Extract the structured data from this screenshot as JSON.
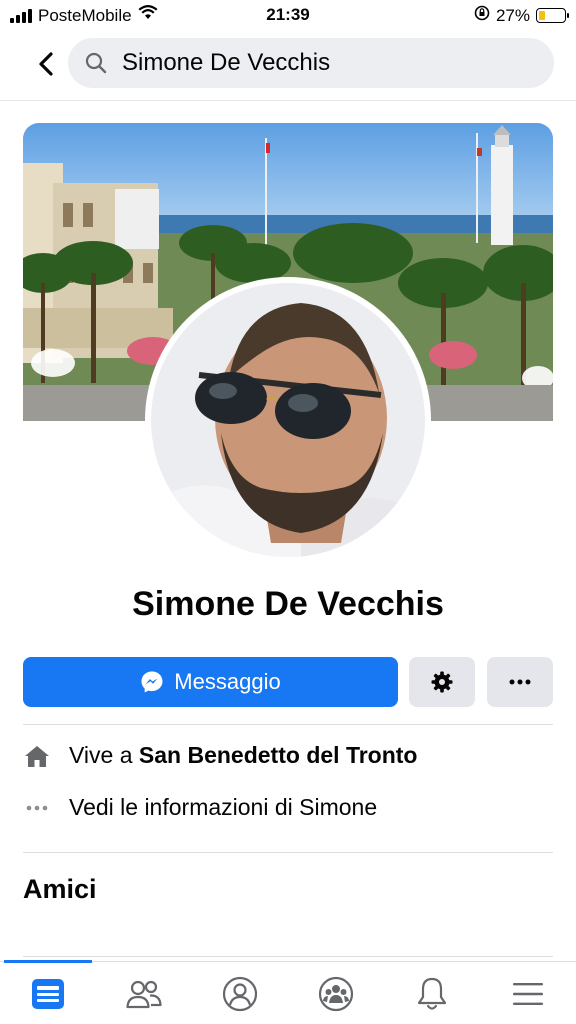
{
  "status_bar": {
    "carrier": "PosteMobile",
    "time": "21:39",
    "battery_percent": "27%",
    "battery_level": 0.27,
    "icons": [
      "signal-icon",
      "wifi-icon",
      "orientation-lock-icon",
      "battery-icon"
    ]
  },
  "header": {
    "back_icon": "chevron-left-icon",
    "search_icon": "search-icon",
    "search_text": "Simone De Vecchis"
  },
  "profile": {
    "name": "Simone De Vecchis"
  },
  "actions": {
    "message_label": "Messaggio",
    "message_icon": "messenger-icon",
    "settings_icon": "gear-icon",
    "more_icon": "more-icon",
    "primary_color": "#1877f2"
  },
  "info": {
    "lives_prefix": "Vive a ",
    "lives_city": "San Benedetto del Tronto",
    "details_label": "Vedi le informazioni di Simone"
  },
  "sections": {
    "friends_title": "Amici"
  },
  "bottom_nav": {
    "items": [
      "feed-icon",
      "friends-icon",
      "profile-icon",
      "groups-icon",
      "notifications-icon",
      "menu-icon"
    ],
    "active": "feed-icon"
  }
}
